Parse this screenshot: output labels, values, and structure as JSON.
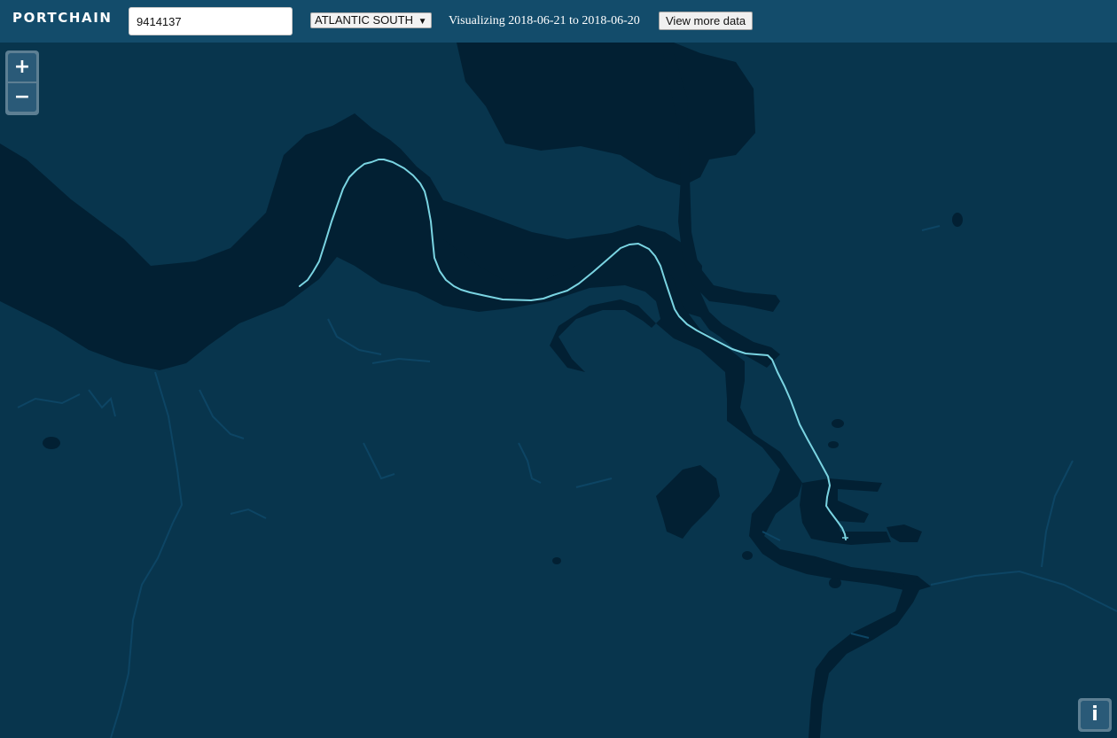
{
  "header": {
    "logo_text": "PORTCHAIN",
    "vessel_search": {
      "value": "9414137",
      "placeholder": ""
    },
    "region_select": {
      "selected": "ATLANTIC SOUTH",
      "arrow": "▼"
    },
    "date_range_text": "Visualizing 2018-06-21 to 2018-06-20",
    "more_data_label": "View more data"
  },
  "map": {
    "zoom_in_label": "+",
    "zoom_out_label": "−",
    "info_label": "i",
    "colors": {
      "land": "#08354d",
      "water": "#022033",
      "vessel_track": "#7ad4e2",
      "land_detail": "#0b4260",
      "topbar": "#134c6b",
      "control": "#2a5a78"
    },
    "icons": [
      "zoom-in-icon",
      "zoom-out-icon",
      "info-icon"
    ]
  }
}
